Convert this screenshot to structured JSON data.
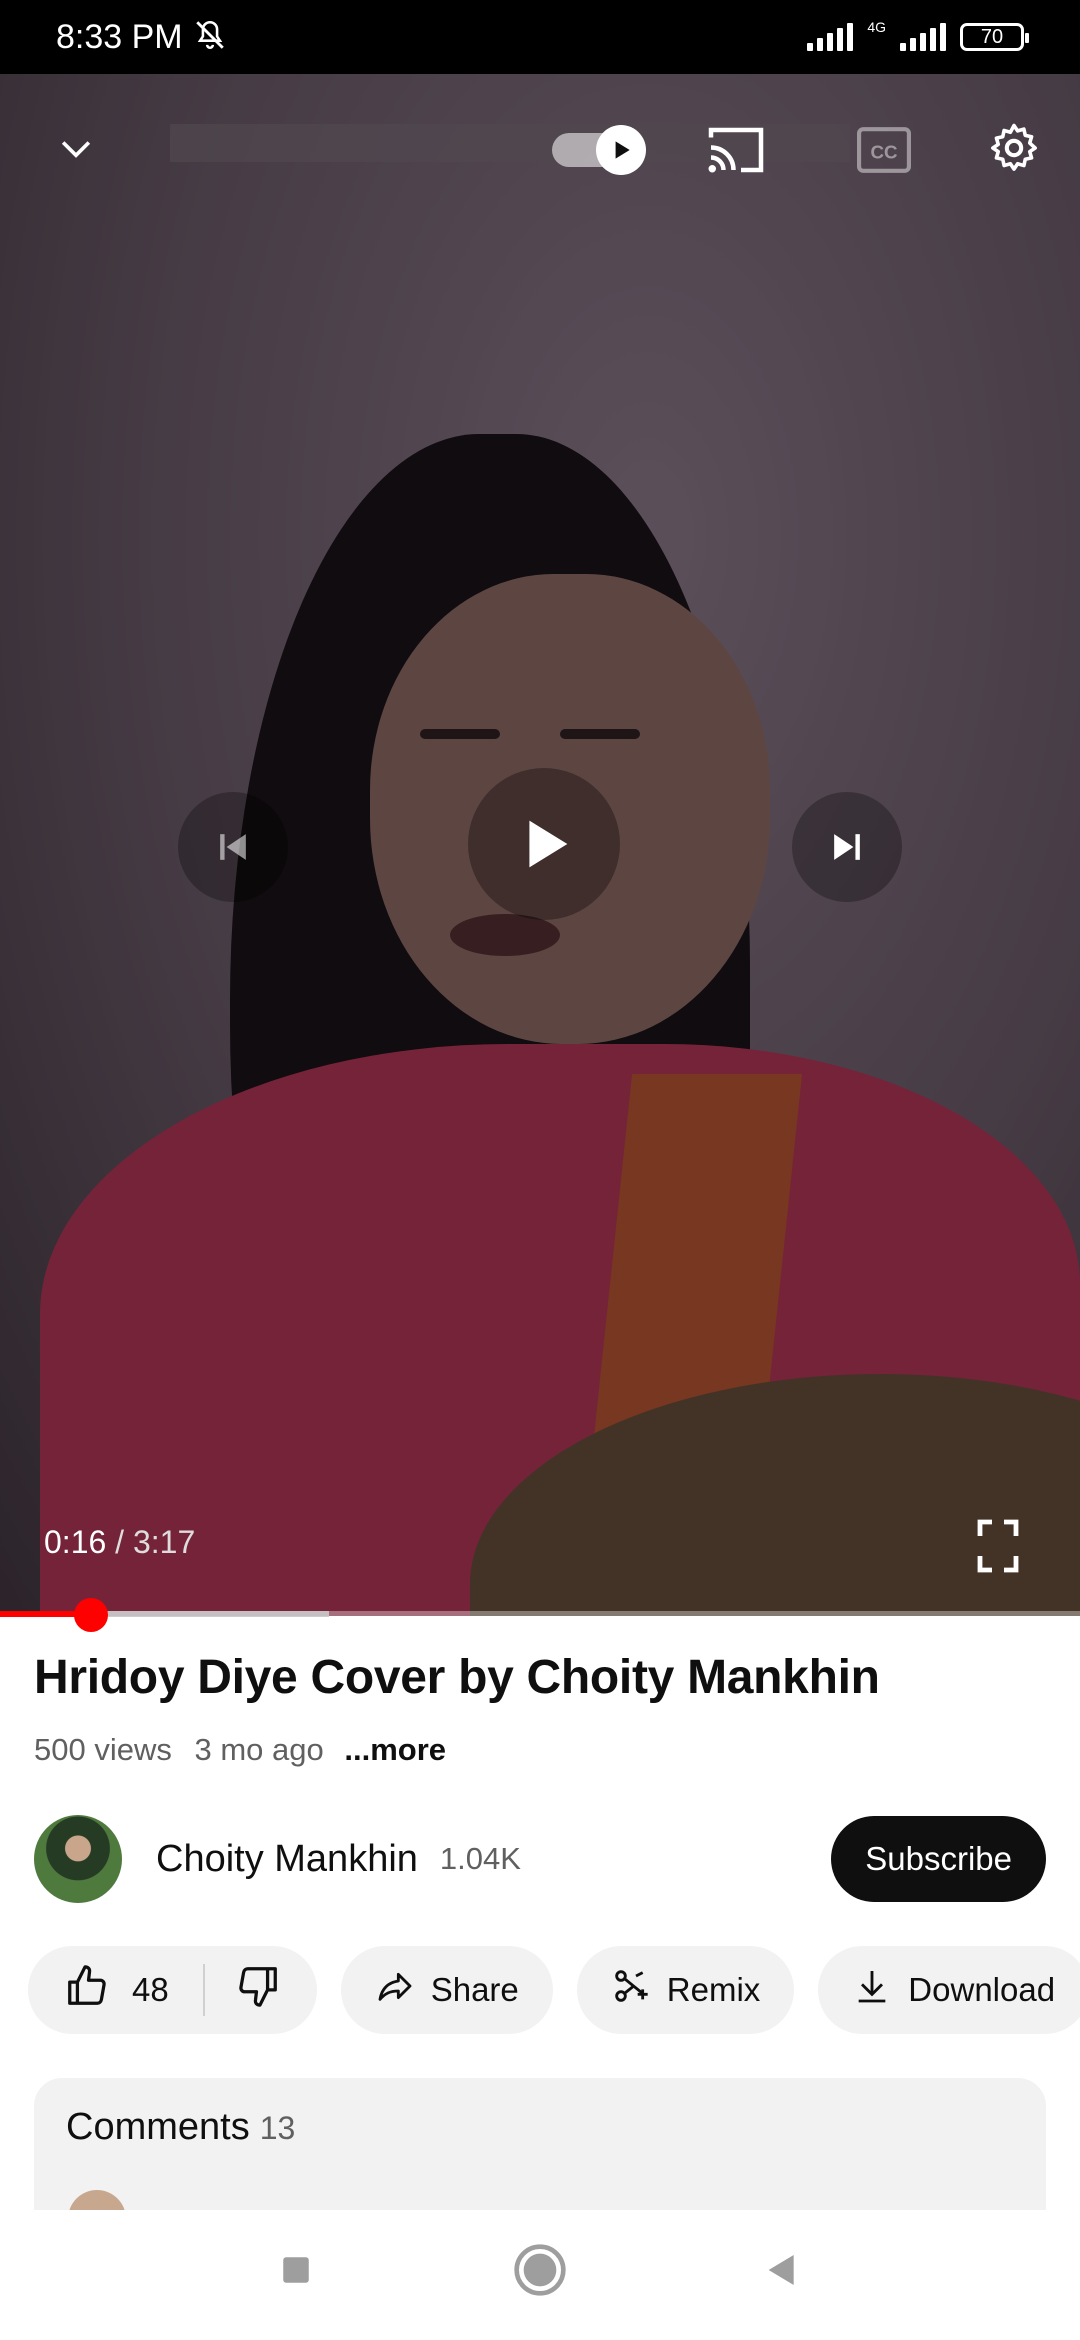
{
  "status_bar": {
    "time": "8:33 PM",
    "network": "4G",
    "battery": "70"
  },
  "player": {
    "current_time": "0:16",
    "separator": "/",
    "duration": "3:17",
    "played_fraction": 0.084,
    "buffered_fraction": 0.305,
    "icons": {
      "minimize": "chevron-down-icon",
      "autoplay": "autoplay-toggle",
      "cast": "cast-icon",
      "captions": "cc-icon",
      "settings": "gear-icon",
      "previous": "skip-previous-icon",
      "play": "play-icon",
      "next": "skip-next-icon",
      "fullscreen": "fullscreen-icon"
    }
  },
  "video": {
    "title": "Hridoy Diye Cover by Choity Mankhin",
    "views": "500 views",
    "age": "3 mo ago",
    "more_label": "...more"
  },
  "channel": {
    "name": "Choity Mankhin",
    "subscribers": "1.04K",
    "subscribe_label": "Subscribe"
  },
  "actions": {
    "like_count": "48",
    "share_label": "Share",
    "remix_label": "Remix",
    "download_label": "Download"
  },
  "comments": {
    "label": "Comments",
    "count": "13"
  },
  "colors": {
    "accent": "#ff0000",
    "subscribe_bg": "#0f0f0f",
    "pill_bg": "#f2f2f2"
  }
}
